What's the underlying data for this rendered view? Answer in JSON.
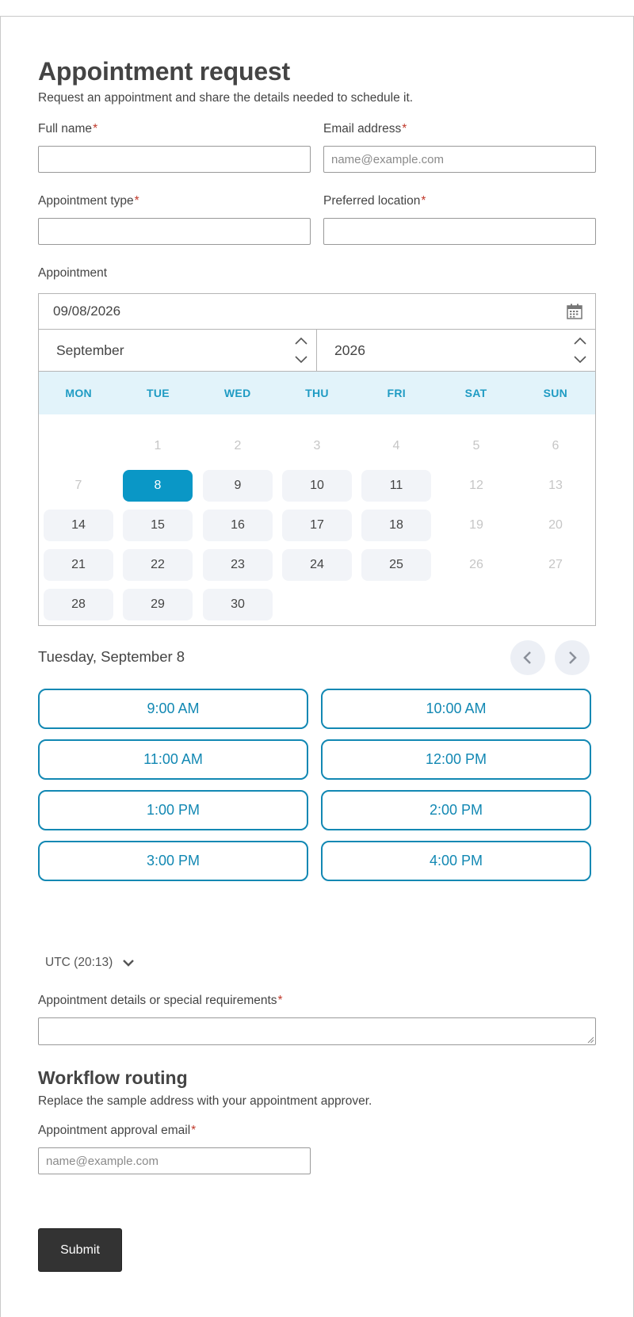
{
  "form": {
    "title": "Appointment request",
    "description": "Request an appointment and share the details needed to schedule it.",
    "required_marker": "*",
    "full_name": {
      "label": "Full name",
      "value": ""
    },
    "email": {
      "label": "Email address",
      "placeholder": "name@example.com",
      "value": ""
    },
    "appointment_type": {
      "label": "Appointment type",
      "value": ""
    },
    "preferred_location": {
      "label": "Preferred location",
      "value": ""
    },
    "appointment": {
      "label": "Appointment",
      "date_value": "09/08/2026",
      "month": "September",
      "year": "2026",
      "weekdays": [
        "MON",
        "TUE",
        "WED",
        "THU",
        "FRI",
        "SAT",
        "SUN"
      ],
      "weeks": [
        [
          null,
          1,
          2,
          3,
          4,
          5,
          6
        ],
        [
          7,
          8,
          9,
          10,
          11,
          12,
          13
        ],
        [
          14,
          15,
          16,
          17,
          18,
          19,
          20
        ],
        [
          21,
          22,
          23,
          24,
          25,
          26,
          27
        ],
        [
          28,
          29,
          30,
          null,
          null,
          null,
          null
        ]
      ],
      "available_days": [
        8,
        9,
        10,
        11,
        14,
        15,
        16,
        17,
        18,
        21,
        22,
        23,
        24,
        25,
        28,
        29,
        30
      ],
      "selected_day": 8,
      "selected_date_heading": "Tuesday, September 8",
      "time_slots": [
        "9:00 AM",
        "10:00 AM",
        "11:00 AM",
        "12:00 PM",
        "1:00 PM",
        "2:00 PM",
        "3:00 PM",
        "4:00 PM"
      ],
      "timezone": "UTC (20:13)"
    },
    "details": {
      "label": "Appointment details or special requirements",
      "value": ""
    },
    "workflow": {
      "title": "Workflow routing",
      "description": "Replace the sample address with your appointment approver.",
      "approval_email": {
        "label": "Appointment approval email",
        "placeholder": "name@example.com",
        "value": ""
      }
    },
    "submit_label": "Submit"
  },
  "colors": {
    "accent": "#0a97c6",
    "slot_border": "#1288b3",
    "weekday_header_bg": "#e2f3fa",
    "required": "#c0392b",
    "submit_bg": "#333333"
  },
  "icons": [
    "calendar-icon",
    "chevron-up-icon",
    "chevron-down-icon",
    "chevron-left-icon",
    "chevron-right-icon"
  ]
}
